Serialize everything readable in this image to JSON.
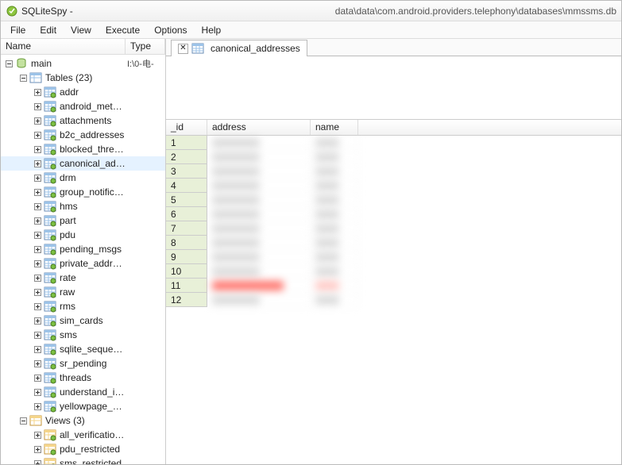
{
  "title": {
    "app_name": "SQLiteSpy",
    "separator": " -",
    "db_path": "data\\data\\com.android.providers.telephony\\databases\\mmssms.db"
  },
  "menu": {
    "file": "File",
    "edit": "Edit",
    "view": "View",
    "execute": "Execute",
    "options": "Options",
    "help": "Help"
  },
  "tree_headers": {
    "name": "Name",
    "type": "Type"
  },
  "tree": {
    "main": {
      "label": "main",
      "type": "I:\\0-电-"
    },
    "tables": {
      "label": "Tables (23)"
    },
    "table_items": [
      "addr",
      "android_metadata",
      "attachments",
      "b2c_addresses",
      "blocked_threads",
      "canonical_addresses",
      "drm",
      "group_notifications",
      "hms",
      "part",
      "pdu",
      "pending_msgs",
      "private_addresses",
      "rate",
      "raw",
      "rms",
      "sim_cards",
      "sms",
      "sqlite_sequence",
      "sr_pending",
      "threads",
      "understand_info",
      "yellowpage_addresses"
    ],
    "views": {
      "label": "Views (3)"
    },
    "view_items": [
      "all_verification_code",
      "pdu_restricted",
      "sms_restricted"
    ]
  },
  "tab": {
    "label": "canonical_addresses"
  },
  "grid": {
    "headers": {
      "id": "_id",
      "address": "address",
      "name": "name"
    },
    "rows": [
      1,
      2,
      3,
      4,
      5,
      6,
      7,
      8,
      9,
      10,
      11,
      12
    ]
  }
}
